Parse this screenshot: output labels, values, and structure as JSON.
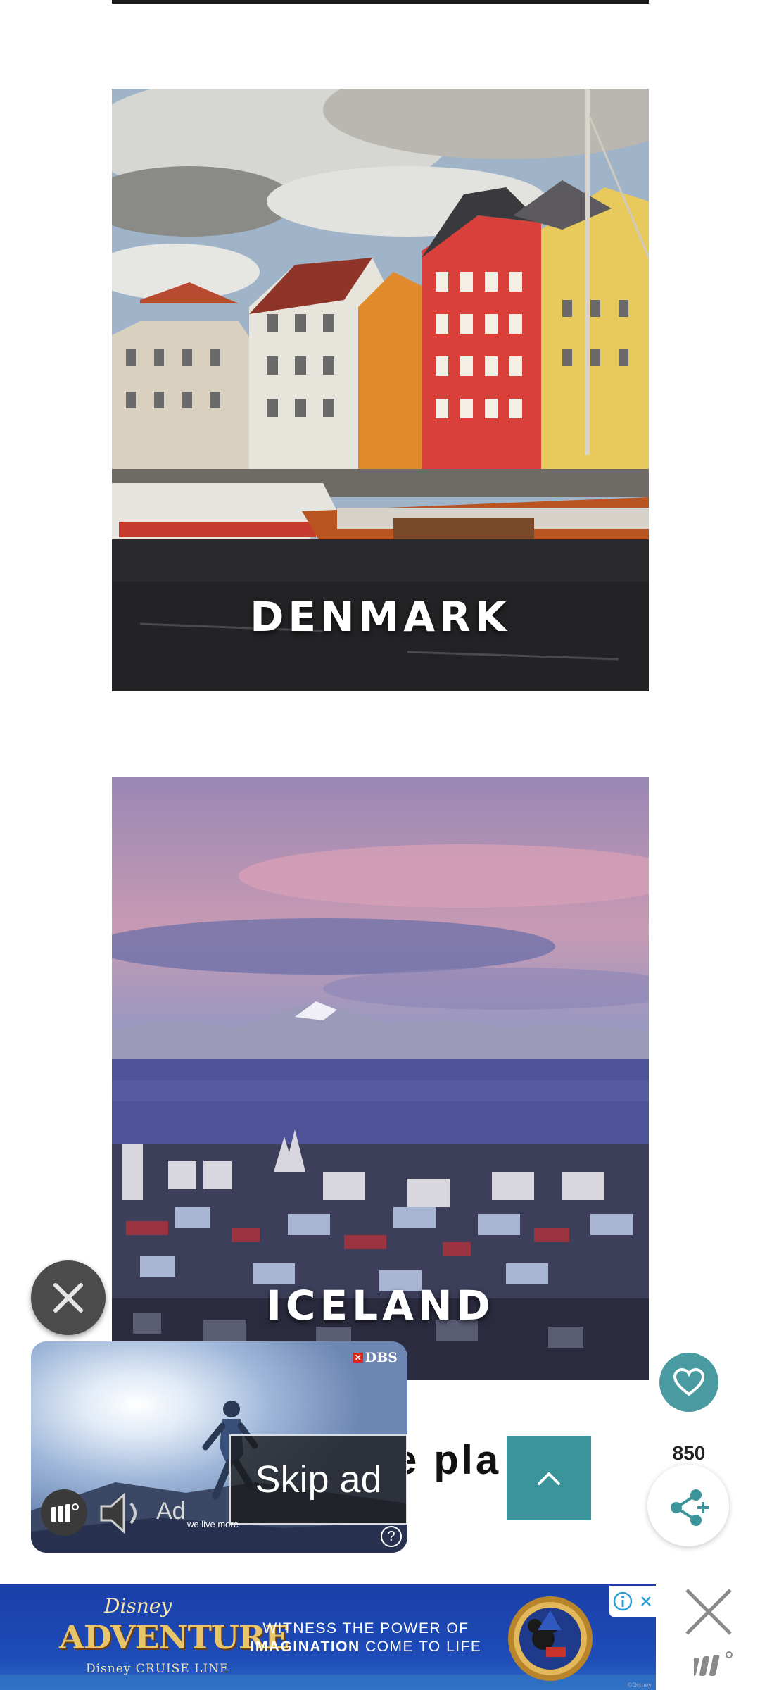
{
  "photos": {
    "denmark": {
      "label": "DENMARK"
    },
    "iceland": {
      "label": "ICELAND"
    }
  },
  "partial_text": "e pla",
  "video_ad": {
    "brand": "DBS",
    "skip_label": "Skip ad",
    "ad_label": "Ad",
    "ad_caption": "we live more",
    "help": "?"
  },
  "share": {
    "count": "850"
  },
  "banner_ad": {
    "disney": "Disney",
    "title": "ADVENTURE",
    "cruise_line": "Disney CRUISE LINE",
    "tagline_line1": "WITNESS THE POWER OF",
    "tagline_bold": "IMAGINATION",
    "tagline_rest": " COME TO LIFE",
    "copyright": "©Disney"
  },
  "colors": {
    "teal": "#3c949b",
    "banner_blue": "#1740a8"
  },
  "icons": [
    "close-icon",
    "speaker-icon",
    "help-icon",
    "chevron-up-icon",
    "heart-icon",
    "share-icon",
    "adchoices-icon",
    "mediavine-logo"
  ]
}
